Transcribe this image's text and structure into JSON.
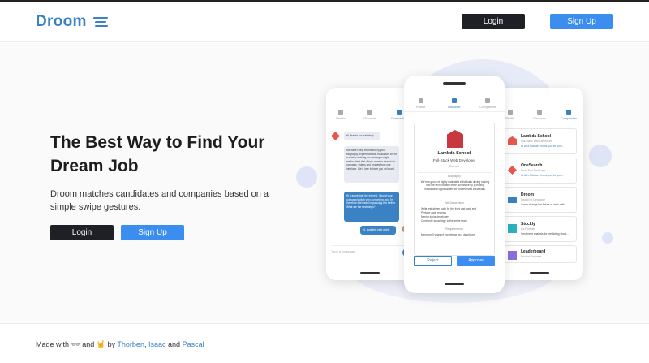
{
  "brand": {
    "name": "Droom",
    "color": "#3b82c4"
  },
  "nav": {
    "login_label": "Login",
    "signup_label": "Sign Up"
  },
  "hero": {
    "title": "The Best Way to Find Your Dream Job",
    "subtitle": "Droom matches candidates and companies based on a simple swipe gestures.",
    "login_label": "Login",
    "signup_label": "Sign Up"
  },
  "phone_tabs": [
    "Profile",
    "Discover",
    "Companies"
  ],
  "chat": {
    "messages": [
      {
        "from": "in",
        "text": "Hi, thanks for matching!"
      },
      {
        "from": "in",
        "text": "We were really impressed by your biography, experience and education! We're a startup working on creating a single media client that allows users to search for podcasts, videos and images from one interface. We'd love to have you on board."
      },
      {
        "from": "out",
        "text": "Hi, I appreciate the interest. I found your company's pitch very compelling, and I'm therefore interested in pursuing this further. What are the next steps?"
      },
      {
        "from": "out",
        "text": "Hi, available next week."
      }
    ],
    "placeholder": "Type a message..."
  },
  "card": {
    "company": "Lambda School",
    "role": "Full-Stack Web Developer",
    "location": "Remote",
    "biography_heading": "Biography",
    "biography": "We're a group of highly motivated individuals driving making into the tech industry more accessible by providing educational opportunities for underserved individuals.",
    "job_heading": "Job Description",
    "job_items": [
      "Write test-driven code for the front and back end",
      "Perform code reviews",
      "Mentor junior developers",
      "Contribute knowledge to the entire team"
    ],
    "req_heading": "Requirements",
    "req_items": [
      "Minimum 3 years of experience as a developer"
    ],
    "reject_label": "Reject",
    "approve_label": "Approve"
  },
  "companies": [
    {
      "name": "Lambda School",
      "sub": "Full-Stack Web Developer",
      "desc": "Hi Alex Michael, thank you for your..."
    },
    {
      "name": "OneSearch",
      "sub": "Front-End Developer",
      "desc": "Hi Alex Michael, thank you for your..."
    },
    {
      "name": "Droom",
      "sub": "Back-End Developer",
      "desc": "Come change the future of work with..."
    },
    {
      "name": "Stockly",
      "sub": "Co-Founder",
      "desc": "Sentiment analysis for predicting stock..."
    },
    {
      "name": "Leaderboard",
      "sub": "Product Engineer",
      "desc": ""
    }
  ],
  "footer": {
    "made_with": "Made with",
    "and": "and",
    "by": "by",
    "author1": "Thorben",
    "sep": ",",
    "author2": "Isaac",
    "and2": "and",
    "author3": "Pascal",
    "icon1": "glasses-icon",
    "icon2": "rock-hand-icon"
  }
}
